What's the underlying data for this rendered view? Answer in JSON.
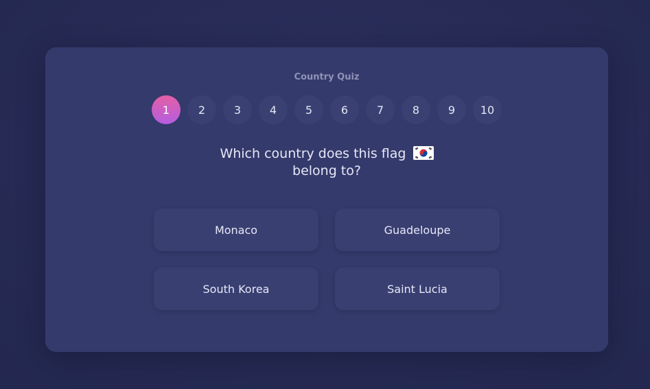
{
  "quiz": {
    "title": "Country Quiz",
    "steps": [
      "1",
      "2",
      "3",
      "4",
      "5",
      "6",
      "7",
      "8",
      "9",
      "10"
    ],
    "active_step": "1",
    "question_line1": "Which country does this flag",
    "question_line2": "belong to?",
    "flag_icon": "south-korea-flag-icon",
    "answers": [
      "Monaco",
      "Guadeloupe",
      "South Korea",
      "Saint Lucia"
    ]
  },
  "colors": {
    "background": "#272c54",
    "card": "#343a6b",
    "button": "#393f71",
    "active_gradient_start": "#e45fa5",
    "active_gradient_end": "#b45ee0",
    "title_text": "#8f93b8",
    "text": "#e6e8f7"
  }
}
